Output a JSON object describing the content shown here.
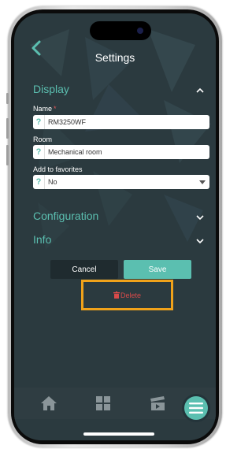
{
  "header": {
    "title": "Settings"
  },
  "sections": {
    "display": {
      "label": "Display",
      "expanded": true
    },
    "configuration": {
      "label": "Configuration",
      "expanded": false
    },
    "info": {
      "label": "Info",
      "expanded": false
    }
  },
  "form": {
    "name": {
      "label": "Name",
      "required_mark": "*",
      "value": "RM3250WF"
    },
    "room": {
      "label": "Room",
      "value": "Mechanical room"
    },
    "favorites": {
      "label": "Add to favorites",
      "value": "No"
    },
    "help_icon_text": "?"
  },
  "actions": {
    "cancel_label": "Cancel",
    "save_label": "Save",
    "delete_label": "Delete"
  },
  "nav": {
    "items": [
      "home-icon",
      "grid-icon",
      "clapperboard-icon"
    ],
    "fab_icon": "menu-icon"
  },
  "colors": {
    "accent": "#5bbfb0",
    "background": "#2b3a3f",
    "delete": "#d94a4a",
    "highlight": "#f0a21a"
  }
}
